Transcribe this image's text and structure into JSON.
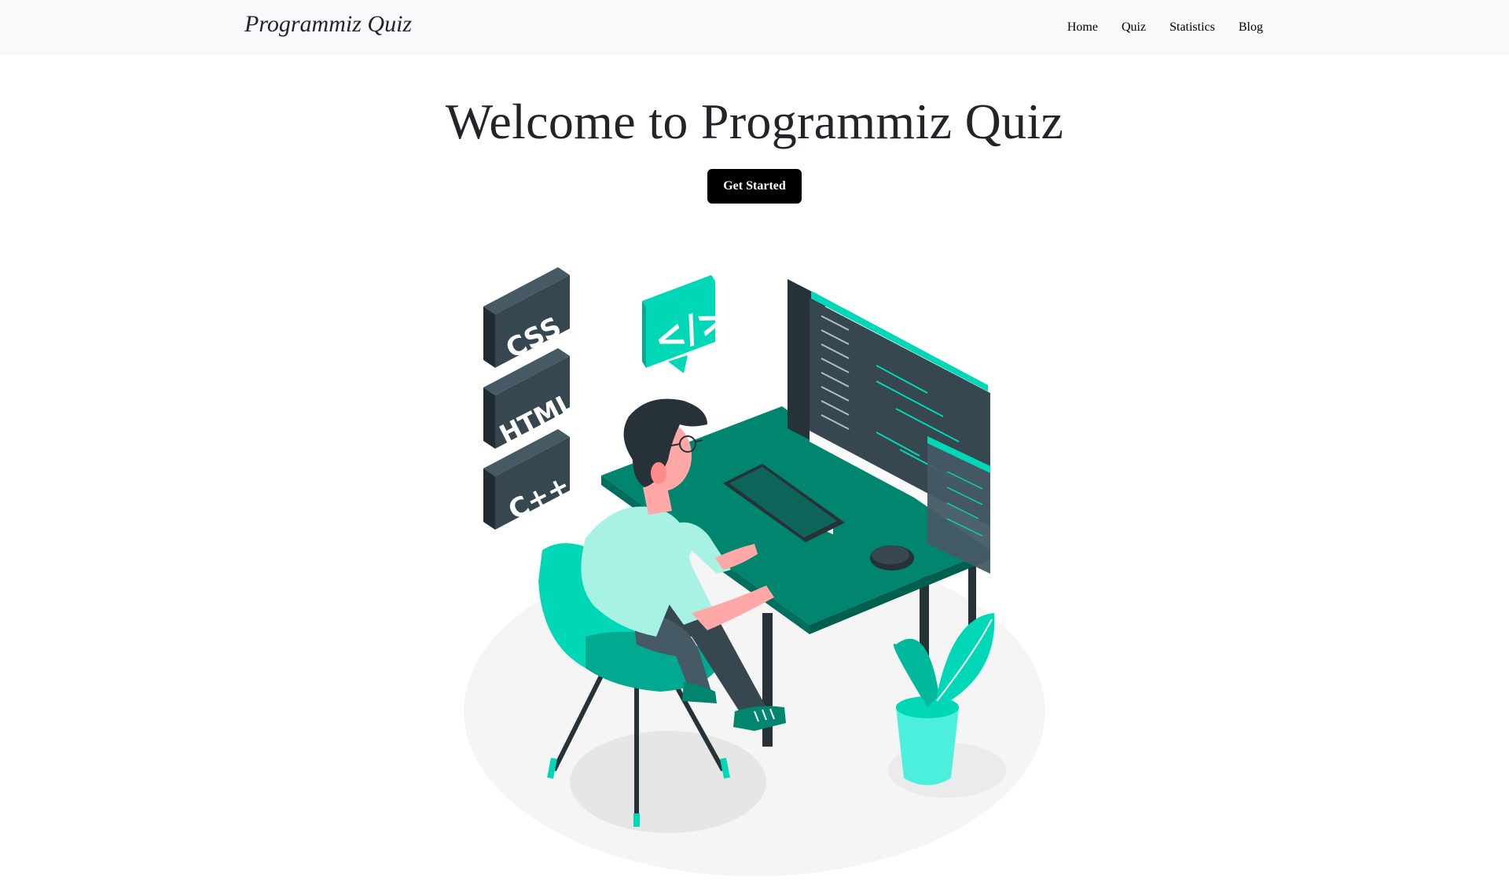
{
  "navbar": {
    "brand": "Programmiz Quiz",
    "links": [
      {
        "label": "Home"
      },
      {
        "label": "Quiz"
      },
      {
        "label": "Statistics"
      },
      {
        "label": "Blog"
      }
    ]
  },
  "hero": {
    "title": "Welcome to Programmiz Quiz",
    "cta_label": "Get Started"
  },
  "illustration": {
    "tags": [
      "CSS",
      "HTML",
      "C++"
    ],
    "bubble_text": "</>",
    "colors": {
      "accent": "#00D7B7",
      "accent_light": "#A8F2E3",
      "desk": "#00856F",
      "dark": "#263238",
      "skin": "#FFA8A7",
      "floor": "#F5F5F5"
    }
  }
}
